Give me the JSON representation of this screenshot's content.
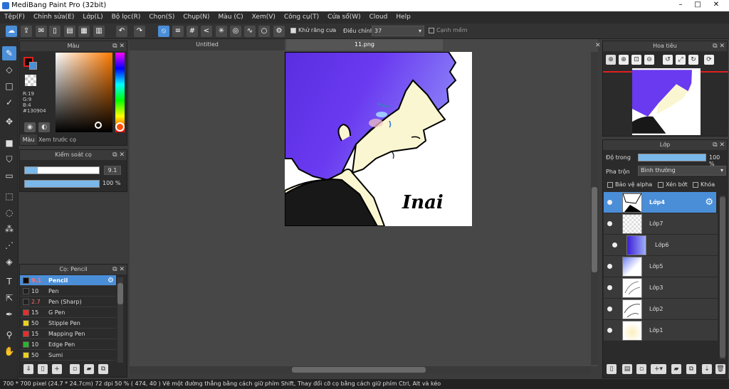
{
  "app": {
    "title": "MediBang Paint Pro (32bit)"
  },
  "menu": [
    "Tệp(F)",
    "Chỉnh sửa(E)",
    "Lớp(L)",
    "Bộ lọc(R)",
    "Chọn(S)",
    "Chụp(N)",
    "Màu (C)",
    "Xem(V)",
    "Công cụ(T)",
    "Cửa sổ(W)",
    "Cloud",
    "Help"
  ],
  "toolbar": {
    "antialias_label": "Khử răng cưa",
    "adjust_label": "Điều chỉnh",
    "adjust_value": "37",
    "edge_label": "Cạnh mềm"
  },
  "color_panel": {
    "title": "Màu",
    "r": "R:19",
    "g": "G:9",
    "b": "B:4",
    "hex": "#130904",
    "tab_color": "Màu",
    "tab_preview": "Xem trước cọ",
    "accent": "#4a8ed8"
  },
  "brush_control": {
    "title": "Kiểm soát cọ",
    "size": "9.1",
    "opacity": "100 %"
  },
  "brush_panel": {
    "title": "Cọ: Pencil",
    "items": [
      {
        "size": "9.1",
        "name": "Pencil",
        "color": "#130904"
      },
      {
        "size": "10",
        "name": "Pen",
        "color": "#222222"
      },
      {
        "size": "2.7",
        "name": "Pen (Sharp)",
        "color": "#222222"
      },
      {
        "size": "15",
        "name": "G Pen",
        "color": "#e03030"
      },
      {
        "size": "50",
        "name": "Stipple Pen",
        "color": "#e8d020"
      },
      {
        "size": "15",
        "name": "Mapping Pen",
        "color": "#e03030"
      },
      {
        "size": "10",
        "name": "Edge Pen",
        "color": "#30b030"
      },
      {
        "size": "50",
        "name": "Sumi",
        "color": "#e8d020"
      }
    ]
  },
  "tabs": [
    "Untitled",
    "11.png"
  ],
  "canvas": {
    "signature": "Inai"
  },
  "navigator": {
    "title": "Hoa tiêu"
  },
  "layers": {
    "title": "Lớp",
    "opacity_label": "Độ trong",
    "opacity_value": "100 %",
    "blend_label": "Pha trộn",
    "blend_value": "Bình thường",
    "protect_alpha": "Bảo vệ alpha",
    "clipping": "Xén bớt",
    "lock": "Khóa",
    "items": [
      "Lớp4",
      "Lớp7",
      "Lớp6",
      "Lớp5",
      "Lớp3",
      "Lớp2",
      "Lớp1"
    ]
  },
  "status": {
    "text": "700 * 700 pixel   (24.7 * 24.7cm)   72 dpi   50 %   ( 474, 40 )   Vẽ một đường thẳng bằng cách giữ phím Shift, Thay đổi cỡ cọ bằng cách giữ phím Ctrl, Alt và kéo"
  }
}
